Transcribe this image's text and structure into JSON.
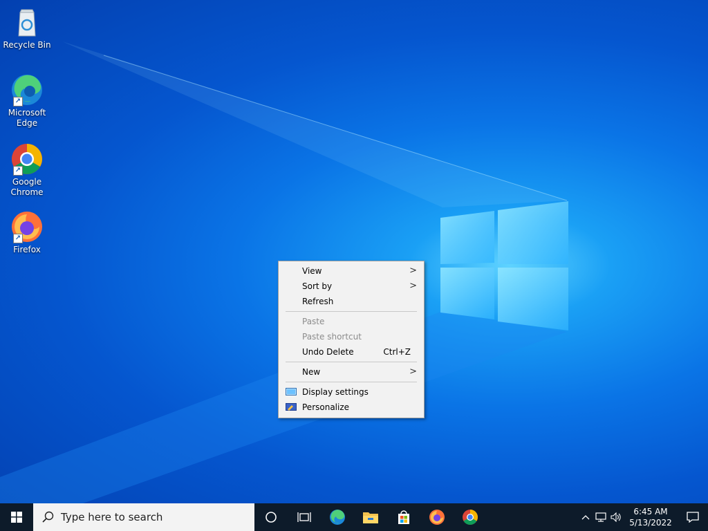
{
  "desktop": {
    "icons": [
      {
        "label": "Recycle Bin"
      },
      {
        "label": "Microsoft Edge"
      },
      {
        "label": "Google Chrome"
      },
      {
        "label": "Firefox"
      }
    ]
  },
  "context_menu": {
    "items": [
      {
        "label": "View",
        "arrow": ">"
      },
      {
        "label": "Sort by",
        "arrow": ">"
      },
      {
        "label": "Refresh"
      },
      {
        "label": "Paste"
      },
      {
        "label": "Paste shortcut"
      },
      {
        "label": "Undo Delete",
        "accelerator": "Ctrl+Z"
      },
      {
        "label": "New",
        "arrow": ">"
      },
      {
        "label": "Display settings"
      },
      {
        "label": "Personalize"
      }
    ]
  },
  "taskbar": {
    "search_placeholder": "Type here to search",
    "clock": {
      "time": "6:45 AM",
      "date": "5/13/2022"
    },
    "icons": [
      "start-icon",
      "search-icon",
      "cortana-icon",
      "task-view-icon",
      "edge-icon",
      "file-explorer-icon",
      "store-icon",
      "firefox-icon",
      "chrome-icon",
      "chevron-up-icon",
      "network-icon",
      "volume-icon",
      "notification-icon"
    ]
  },
  "colors": {
    "taskbar": "#0d1b2a",
    "menu_bg": "#f2f2f2",
    "accent": "#0078d7"
  }
}
